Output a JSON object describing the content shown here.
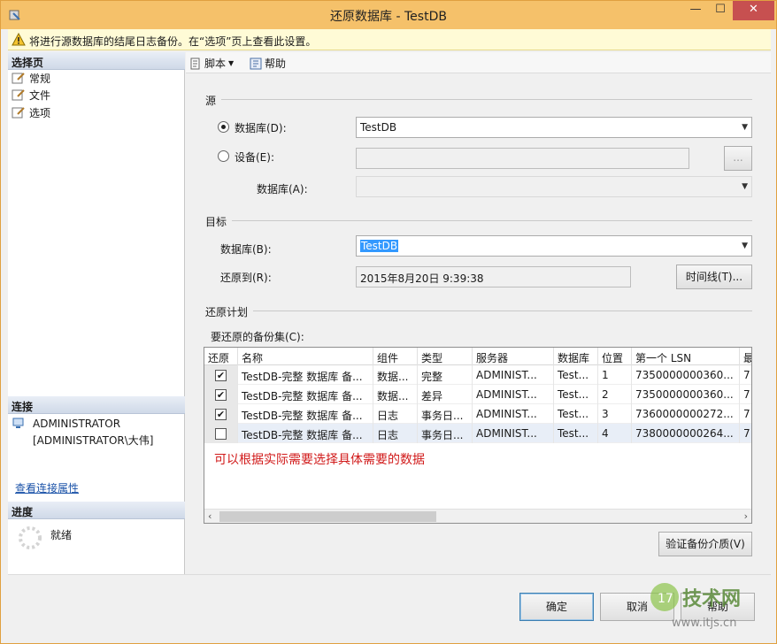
{
  "window": {
    "title": "还原数据库 - TestDB",
    "controls": {
      "minimize": "—",
      "maximize": "☐",
      "close": "✕"
    }
  },
  "warning": {
    "text": "将进行源数据库的结尾日志备份。在“选项”页上查看此设置。"
  },
  "left": {
    "select_page_header": "选择页",
    "pages": [
      {
        "label": "常规"
      },
      {
        "label": "文件"
      },
      {
        "label": "选项"
      }
    ],
    "connection_header": "连接",
    "connection_server": "ADMINISTRATOR",
    "connection_user": "[ADMINISTRATOR\\大伟]",
    "view_connection_link": "查看连接属性",
    "progress_header": "进度",
    "progress_status": "就绪"
  },
  "toolbar": {
    "script": "脚本",
    "help": "帮助"
  },
  "source": {
    "group": "源",
    "database_radio": "数据库(D):",
    "device_radio": "设备(E):",
    "database_value": "TestDB",
    "device_browse": "...",
    "device_database_label": "数据库(A):"
  },
  "target": {
    "group": "目标",
    "database_label": "数据库(B):",
    "database_value": "TestDB",
    "restore_to_label": "还原到(R):",
    "restore_to_value": "2015年8月20日 9:39:38",
    "timeline_button": "时间线(T)..."
  },
  "plan": {
    "group": "还原计划",
    "backup_sets_label": "要还原的备份集(C):",
    "columns": [
      "还原",
      "名称",
      "组件",
      "类型",
      "服务器",
      "数据库",
      "位置",
      "第一个 LSN",
      "最"
    ],
    "rows": [
      {
        "checked": true,
        "name": "TestDB-完整 数据库 备...",
        "component": "数据...",
        "type": "完整",
        "server": "ADMINIST...",
        "db": "Test...",
        "pos": "1",
        "lsn": "7350000000360...",
        "more": "7"
      },
      {
        "checked": true,
        "name": "TestDB-完整 数据库 备...",
        "component": "数据...",
        "type": "差异",
        "server": "ADMINIST...",
        "db": "Test...",
        "pos": "2",
        "lsn": "7350000000360...",
        "more": "7"
      },
      {
        "checked": true,
        "name": "TestDB-完整 数据库 备...",
        "component": "日志",
        "type": "事务日...",
        "server": "ADMINIST...",
        "db": "Test...",
        "pos": "3",
        "lsn": "7360000000272...",
        "more": "7"
      },
      {
        "checked": false,
        "name": "TestDB-完整 数据库 备...",
        "component": "日志",
        "type": "事务日...",
        "server": "ADMINIST...",
        "db": "Test...",
        "pos": "4",
        "lsn": "7380000000264...",
        "more": "7"
      }
    ],
    "annotation": "可以根据实际需要选择具体需要的数据",
    "verify_button": "验证备份介质(V)"
  },
  "buttons": {
    "ok": "确定",
    "cancel": "取消",
    "help": "帮助"
  },
  "watermark": {
    "brand": "技术网",
    "url": "www.itjs.cn"
  },
  "colors": {
    "titlebar": "#f5c16a",
    "annotation": "#d11a1a",
    "link": "#1a52a8"
  }
}
